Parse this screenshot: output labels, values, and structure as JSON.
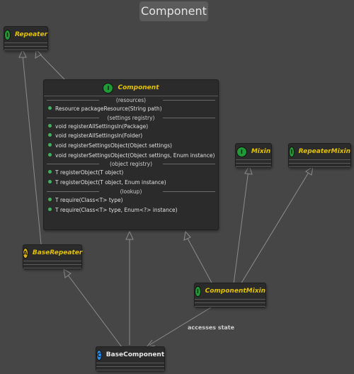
{
  "title": "Component",
  "classes": {
    "repeater": {
      "badge": "I",
      "name": "Repeater"
    },
    "component": {
      "badge": "I",
      "name": "Component",
      "sections": [
        {
          "label": "(resources)",
          "methods": [
            "Resource packageResource(String path)"
          ]
        },
        {
          "label": "(settings registry)",
          "methods": [
            "void registerAllSettingsIn(Package)",
            "void registerAllSettingsIn(Folder)",
            "void registerSettingsObject(Object settings)",
            "void registerSettingsObject(Object settings, Enum instance)"
          ]
        },
        {
          "label": "(object registry)",
          "methods": [
            "T registerObject(T object)",
            "T registerObject(T object, Enum instance)"
          ]
        },
        {
          "label": "(lookup)",
          "methods": [
            "T require(Class<T> type)",
            "T require(Class<T> type, Enum<?> instance)"
          ]
        }
      ]
    },
    "mixin": {
      "badge": "I",
      "name": "Mixin"
    },
    "repeater_mixin": {
      "badge": "I",
      "name": "RepeaterMixin"
    },
    "base_repeater": {
      "badge": "A",
      "name": "BaseRepeater"
    },
    "component_mixin": {
      "badge": "I",
      "name": "ComponentMixin"
    },
    "base_component": {
      "badge": "C",
      "name": "BaseComponent"
    }
  },
  "edges": [
    {
      "from": "BaseRepeater",
      "to": "Repeater",
      "kind": "realization"
    },
    {
      "from": "Component",
      "to": "Repeater",
      "kind": "realization"
    },
    {
      "from": "BaseComponent",
      "to": "BaseRepeater",
      "kind": "realization"
    },
    {
      "from": "BaseComponent",
      "to": "Component",
      "kind": "realization"
    },
    {
      "from": "ComponentMixin",
      "to": "Component",
      "kind": "realization"
    },
    {
      "from": "ComponentMixin",
      "to": "Mixin",
      "kind": "realization"
    },
    {
      "from": "ComponentMixin",
      "to": "RepeaterMixin",
      "kind": "realization"
    },
    {
      "from": "ComponentMixin",
      "to": "BaseComponent",
      "kind": "association",
      "label": "accesses state"
    }
  ],
  "edge_label": "accesses state",
  "colors": {
    "background": "#464646",
    "node_fill": "#2b2b2b",
    "interface_text": "#e3c200",
    "class_text": "#e8e8e8",
    "edge": "#8c8c8c",
    "interface_badge": "#1f9a36",
    "abstract_badge": "#d8b215",
    "class_badge": "#2a8be0"
  }
}
